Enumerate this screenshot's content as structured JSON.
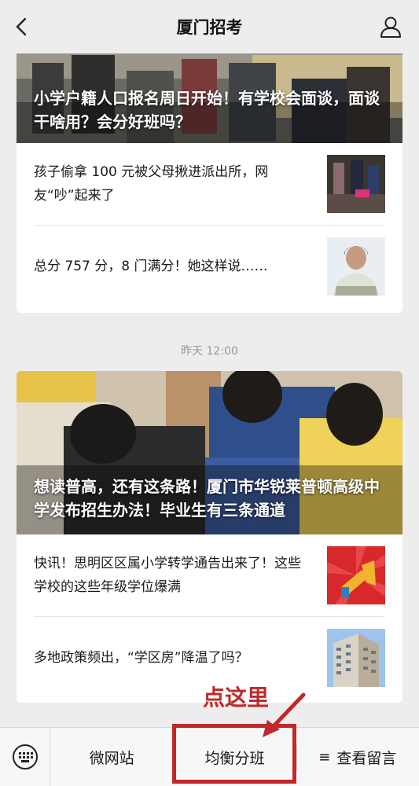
{
  "header": {
    "title": "厦门招考"
  },
  "articles_top": {
    "hero_title": "小学户籍人口报名周日开始！有学校会面谈，面谈干啥用？会分好班吗？",
    "items": [
      {
        "text": "孩子偷拿 100 元被父母揪进派出所，网友“吵”起来了"
      },
      {
        "text": "总分 757 分，8 门满分！她这样说……"
      }
    ]
  },
  "timestamp": "昨天 12:00",
  "articles_bottom": {
    "hero_title": "想读普高，还有这条路！厦门市华锐莱普顿高级中学发布招生办法！毕业生有三条通道",
    "items": [
      {
        "text": "快讯！思明区区属小学转学通告出来了！这些学校的这些年级学位爆满"
      },
      {
        "text": "多地政策频出，“学区房”降温了吗？"
      }
    ]
  },
  "annotation": {
    "label": "点这里",
    "color": "#c0282a"
  },
  "bottom_menu": {
    "items": [
      {
        "label": "微网站"
      },
      {
        "label": "均衡分班"
      },
      {
        "label": "查看留言"
      }
    ]
  },
  "icons": [
    "back-icon",
    "profile-icon",
    "keyboard-icon",
    "menu-lines-icon"
  ]
}
